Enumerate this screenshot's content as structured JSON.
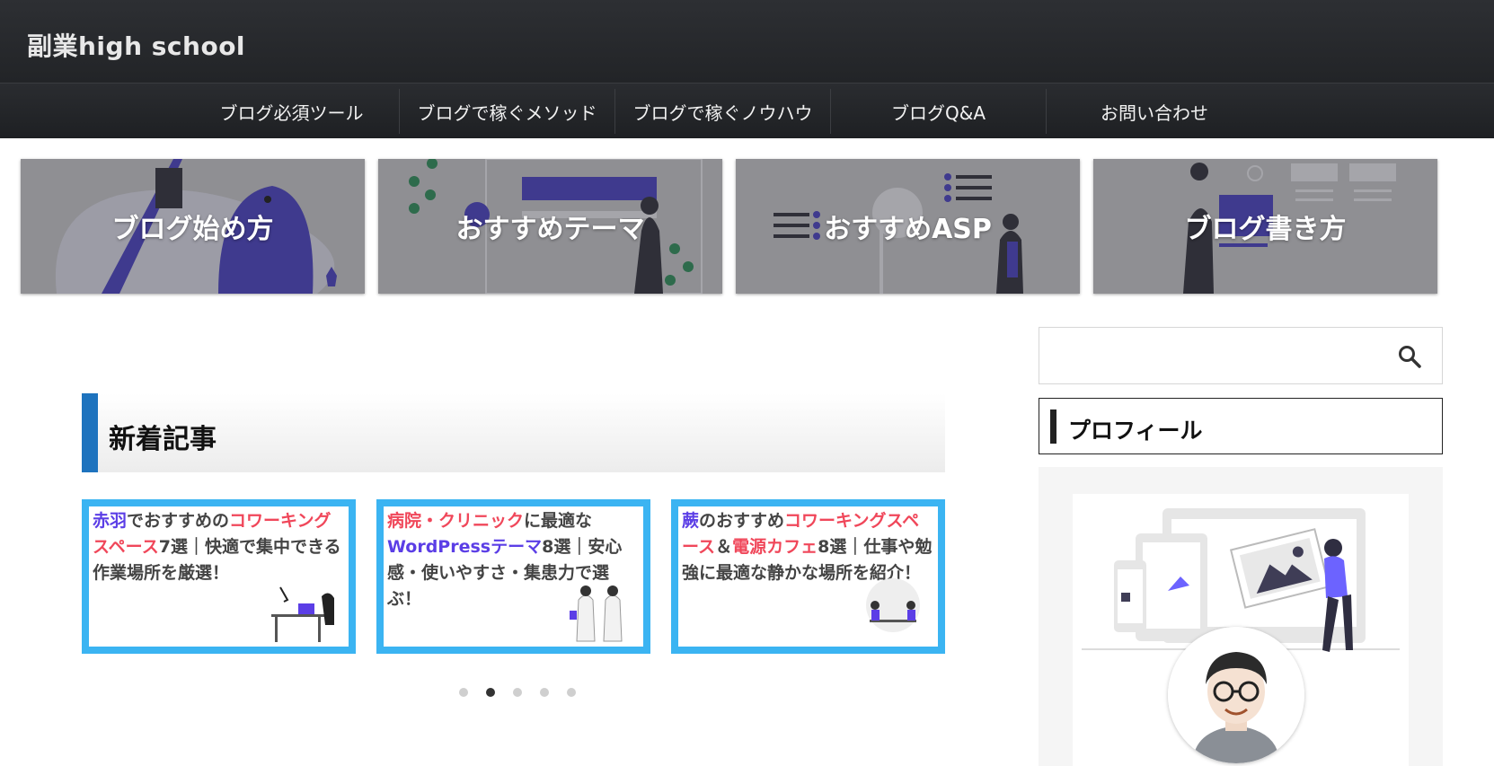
{
  "header": {
    "site_title": "副業high school"
  },
  "nav": {
    "items": [
      "ブログ必須ツール",
      "ブログで稼ぐメソッド",
      "ブログで稼ぐノウハウ",
      "ブログQ&A",
      "お問い合わせ"
    ]
  },
  "categories": [
    "ブログ始め方",
    "おすすめテーマ",
    "おすすめASP",
    "ブログ書き方"
  ],
  "section": {
    "heading": "新着記事"
  },
  "slides": [
    {
      "parts": [
        [
          "赤羽",
          "blue"
        ],
        [
          "でおすすめの",
          ""
        ],
        [
          "コワーキングスペース",
          "red"
        ],
        [
          "7選｜快適で集中できる作業場所を厳選！",
          ""
        ]
      ]
    },
    {
      "parts": [
        [
          "病院・クリニック",
          "red"
        ],
        [
          "に最適な",
          ""
        ],
        [
          "WordPressテーマ",
          "blue"
        ],
        [
          "8選｜安心感・使いやすさ・集患力で選ぶ！",
          ""
        ]
      ]
    },
    {
      "parts": [
        [
          "蕨",
          "blue"
        ],
        [
          "のおすすめ",
          ""
        ],
        [
          "コワーキングスペース",
          "red"
        ],
        [
          "＆",
          ""
        ],
        [
          "電源カフェ",
          "red"
        ],
        [
          "8選｜仕事や勉強に最適な静かな場所を紹介！",
          ""
        ]
      ]
    }
  ],
  "carousel": {
    "dot_count": 5,
    "active_index": 1
  },
  "sidebar": {
    "search": {
      "placeholder": ""
    },
    "profile_heading": "プロフィール"
  },
  "colors": {
    "header": "#2d2f33",
    "accent_blue": "#1e73be",
    "slide_border": "#3bb4f2",
    "highlight_blue": "#5b3ee6",
    "highlight_red": "#f0475a"
  }
}
